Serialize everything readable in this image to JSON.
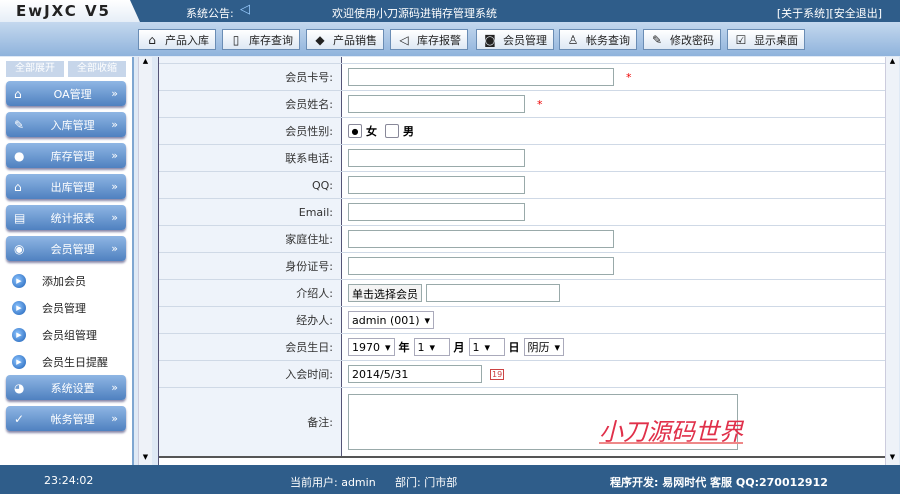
{
  "header": {
    "logo": "EwJXC V5",
    "notice_label": "系统公告:",
    "welcome": "欢迎使用小刀源码进销存管理系统",
    "about": "[关于系统]",
    "logout": "[安全退出]"
  },
  "toolbar": [
    {
      "icon": "house-icon",
      "g": "⌂",
      "label": "产品入库"
    },
    {
      "icon": "book-icon",
      "g": "▯",
      "label": "库存查询"
    },
    {
      "icon": "tag-icon",
      "g": "◆",
      "label": "产品销售"
    },
    {
      "icon": "speaker-icon",
      "g": "◁",
      "label": "库存报警"
    },
    {
      "icon": "member-icon",
      "g": "◙",
      "label": "会员管理"
    },
    {
      "icon": "account-icon",
      "g": "♙",
      "label": "帐务查询"
    },
    {
      "icon": "key-icon",
      "g": "✎",
      "label": "修改密码"
    },
    {
      "icon": "desktop-icon",
      "g": "☑",
      "label": "显示桌面"
    }
  ],
  "sidebar": {
    "expand_all": "全部展开",
    "collapse_all": "全部收缩",
    "menus": [
      {
        "label": "OA管理",
        "g": "⌂"
      },
      {
        "label": "入库管理",
        "g": "✎"
      },
      {
        "label": "库存管理",
        "g": "●"
      },
      {
        "label": "出库管理",
        "g": "⌂"
      },
      {
        "label": "统计报表",
        "g": "▤"
      },
      {
        "label": "会员管理",
        "g": "◉"
      }
    ],
    "sub_items": [
      "添加会员",
      "会员管理",
      "会员组管理",
      "会员生日提醒"
    ],
    "menus2": [
      {
        "label": "系统设置",
        "g": "◕"
      },
      {
        "label": "帐务管理",
        "g": "✓"
      }
    ],
    "chevron": "»"
  },
  "form": {
    "card_label": "会员卡号:",
    "name_label": "会员姓名:",
    "required": "*",
    "gender_label": "会员性别:",
    "female": "女",
    "male": "男",
    "phone_label": "联系电话:",
    "qq_label": "QQ:",
    "email_label": "Email:",
    "address_label": "家庭住址:",
    "id_label": "身份证号:",
    "referrer_label": "介绍人:",
    "referrer_button": "单击选择会员",
    "handler_label": "经办人:",
    "handler_value": "admin (001)",
    "birthday_label": "会员生日:",
    "year": "1970",
    "year_unit": "年",
    "month": "1",
    "month_unit": "月",
    "day": "1",
    "day_unit": "日",
    "calendar": "阴历",
    "join_label": "入会时间:",
    "join_value": "2014/5/31",
    "calendar_icon": "19",
    "notes_label": "备注:"
  },
  "watermark": "小刀源码世界",
  "footer": {
    "time": "23:24:02",
    "user": "当前用户: admin",
    "dept": "部门: 门市部",
    "dev": "程序开发: 易网时代 客服 QQ:270012912"
  }
}
